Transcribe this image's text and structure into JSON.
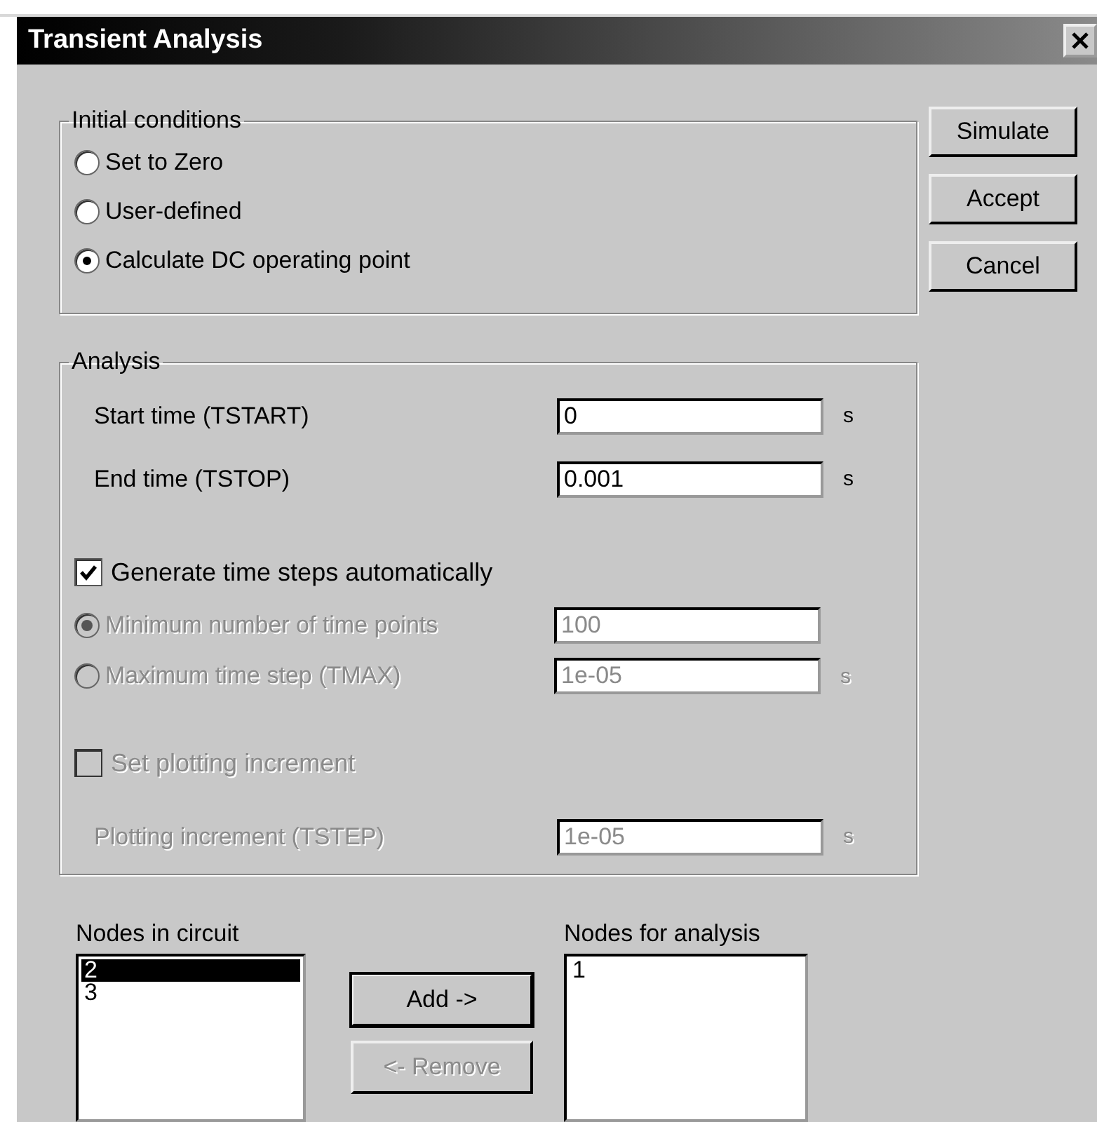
{
  "window": {
    "title": "Transient Analysis"
  },
  "initial_conditions": {
    "title": "Initial conditions",
    "options": [
      {
        "label": "Set to Zero",
        "selected": false
      },
      {
        "label": "User-defined",
        "selected": false
      },
      {
        "label": "Calculate DC operating point",
        "selected": true
      }
    ]
  },
  "buttons": [
    {
      "label": "Simulate"
    },
    {
      "label": "Accept"
    },
    {
      "label": "Cancel"
    }
  ],
  "analysis": {
    "title": "Analysis",
    "rows": [
      {
        "kind": "field",
        "label": "Start time (TSTART)",
        "value": "0",
        "unit": "s",
        "disabled": false
      },
      {
        "kind": "field",
        "label": "End time (TSTOP)",
        "value": "0.001",
        "unit": "s",
        "disabled": false
      },
      {
        "kind": "checkbox",
        "label": "Generate time steps automatically",
        "checked": true,
        "disabled": false
      },
      {
        "kind": "radio",
        "label": "Minimum number of time points",
        "value": "100",
        "selected": true,
        "disabled": true
      },
      {
        "kind": "radio",
        "label": "Maximum time step (TMAX)",
        "value": "1e-05",
        "unit": "s",
        "selected": false,
        "disabled": true
      },
      {
        "kind": "checkbox",
        "label": "Set plotting increment",
        "checked": false,
        "disabled": true
      },
      {
        "kind": "field",
        "label": "Plotting increment (TSTEP)",
        "value": "1e-05",
        "unit": "s",
        "disabled": true
      }
    ]
  },
  "nodes_in_circuit": {
    "label": "Nodes in circuit",
    "items": [
      {
        "text": "2",
        "selected": true
      },
      {
        "text": "3",
        "selected": false
      }
    ]
  },
  "node_buttons": [
    {
      "label": "Add ->",
      "disabled": false,
      "default": true
    },
    {
      "label": "<- Remove",
      "disabled": true,
      "default": false
    }
  ],
  "nodes_for_analysis": {
    "label": "Nodes for analysis",
    "items": [
      {
        "text": "1",
        "selected": false
      }
    ]
  }
}
